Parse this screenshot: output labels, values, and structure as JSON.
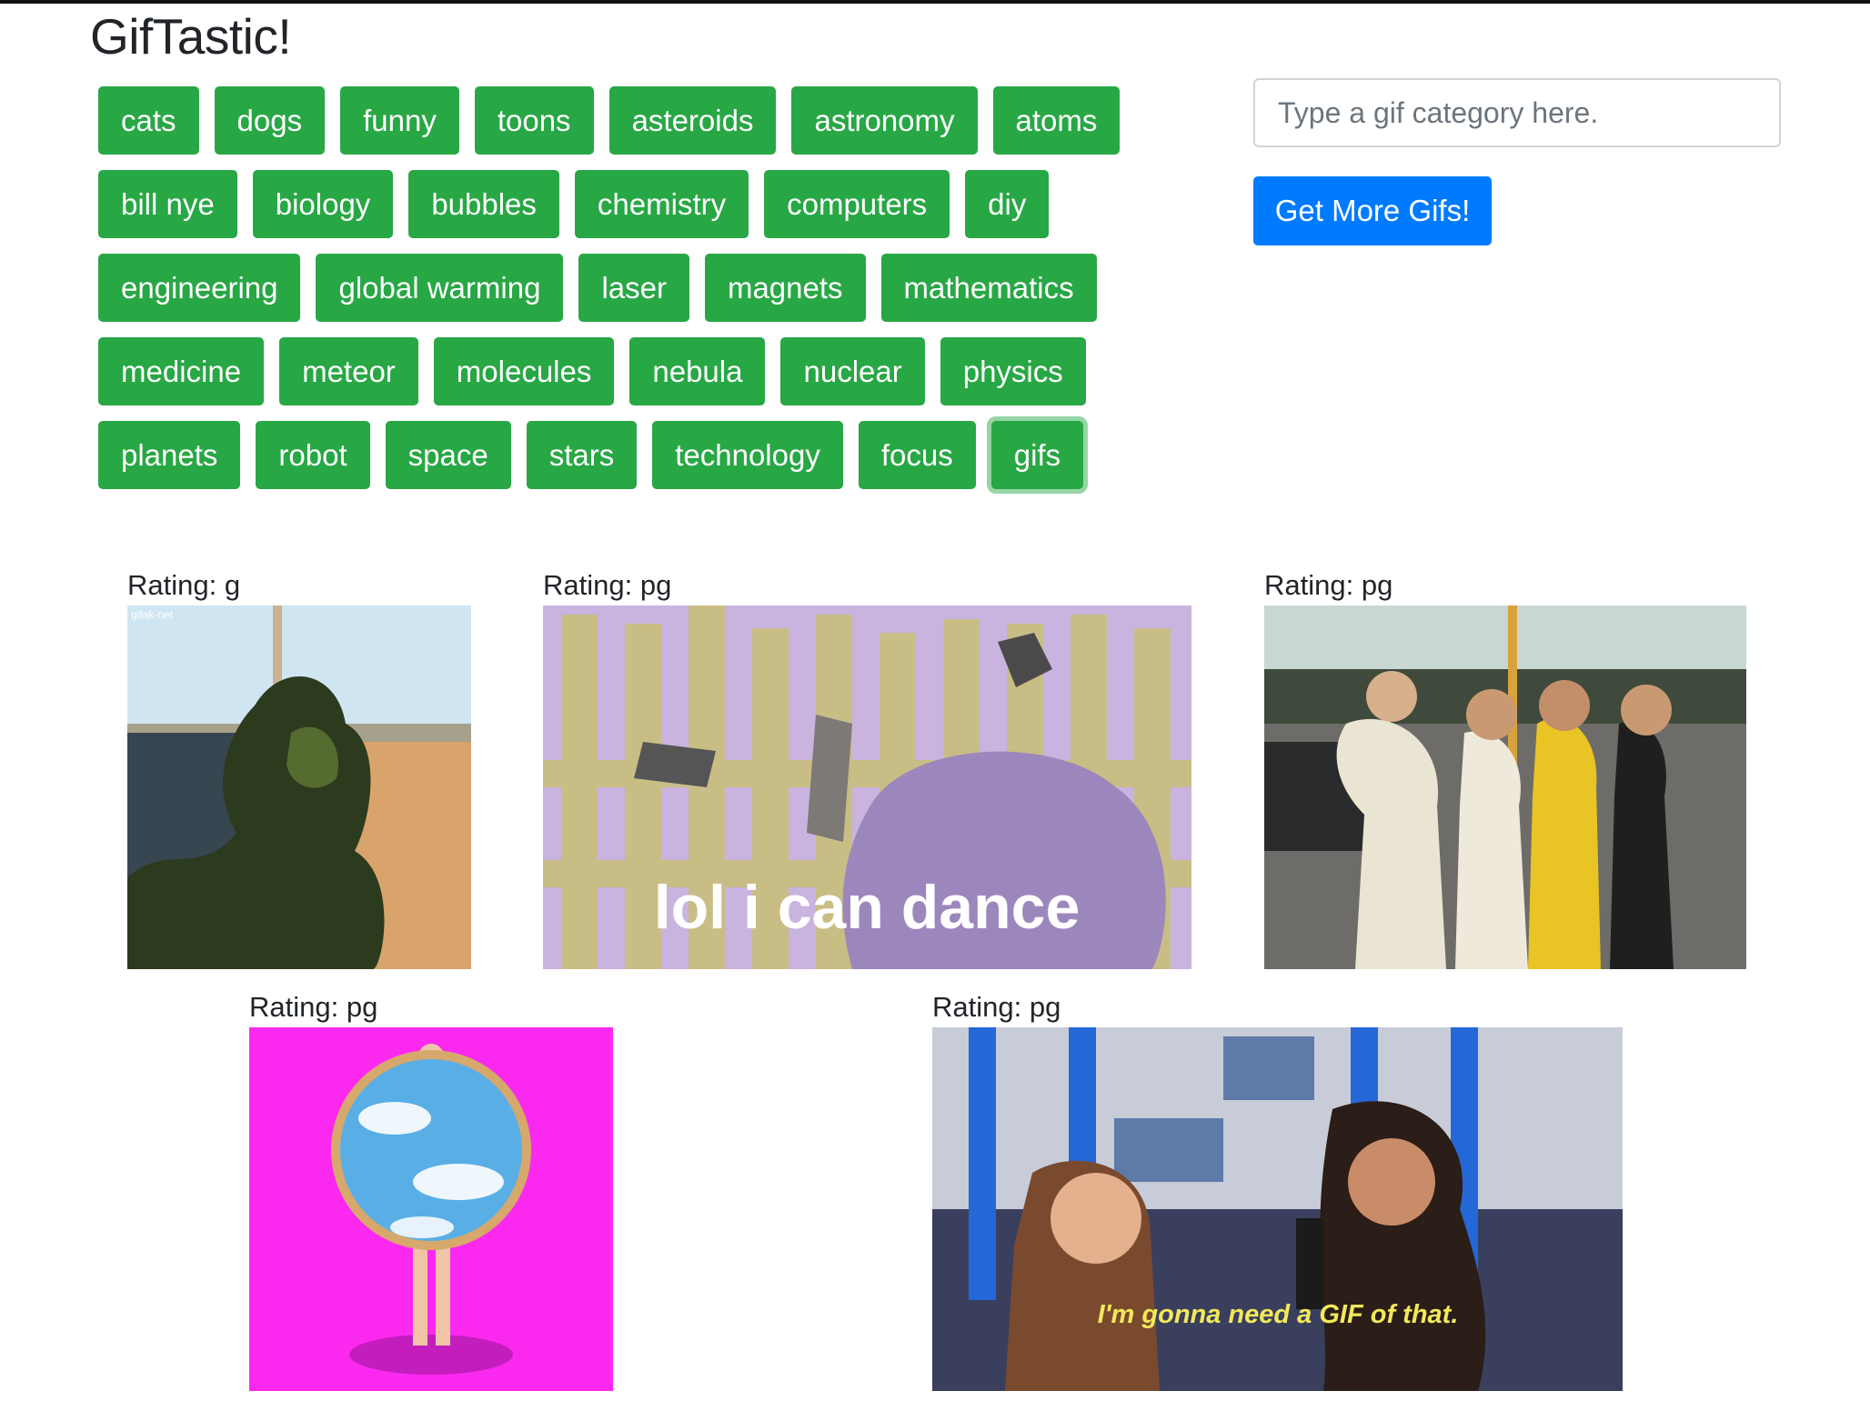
{
  "app": {
    "title": "GifTastic!"
  },
  "topics": [
    [
      "cats",
      "dogs",
      "funny",
      "toons",
      "asteroids",
      "astronomy",
      "atoms"
    ],
    [
      "bill nye",
      "biology",
      "bubbles",
      "chemistry",
      "computers",
      "diy"
    ],
    [
      "engineering",
      "global warming",
      "laser",
      "magnets",
      "mathematics"
    ],
    [
      "medicine",
      "meteor",
      "molecules",
      "nebula",
      "nuclear",
      "physics"
    ],
    [
      "planets",
      "robot",
      "space",
      "stars",
      "technology",
      "focus",
      "gifs"
    ]
  ],
  "focused_topic": "gifs",
  "search": {
    "placeholder": "Type a gif category here.",
    "value": ""
  },
  "submit": {
    "label": "Get More Gifs!"
  },
  "gifs": [
    {
      "rating": "Rating: g",
      "watermark": "gifak-net"
    },
    {
      "rating": "Rating: pg",
      "caption": "lol i can dance"
    },
    {
      "rating": "Rating: pg"
    },
    {
      "rating": "Rating: pg"
    },
    {
      "rating": "Rating: pg",
      "caption": "I'm gonna need a GIF of that."
    }
  ],
  "colors": {
    "button_green": "#28a745",
    "button_blue": "#007bff",
    "magenta_bg": "#fb29ef"
  }
}
